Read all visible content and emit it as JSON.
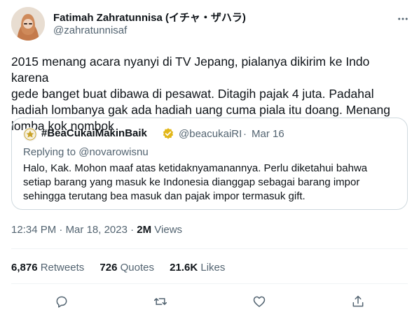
{
  "author": {
    "name": "Fatimah Zahratunnisa (イチャ・ザハラ)",
    "handle": "@zahratunnisaf"
  },
  "tweet": {
    "text": "2015 menang acara nyanyi di TV Jepang, pialanya dikirim ke Indo karena\ngede banget buat dibawa di pesawat. Ditagih pajak 4 juta. Padahal\nhadiah lombanya gak ada hadiah uang cuma piala itu doang. Menang\nlomba kok nombok"
  },
  "quote": {
    "name": "#BeaCukaiMakinBaik",
    "handle": "@beacukaiRI",
    "dot": "·",
    "date": "Mar 16",
    "replying_prefix": "Replying to ",
    "replying_to": "@novarowisnu",
    "text": "Halo, Kak. Mohon maaf atas ketidaknyamanannya. Perlu diketahui bahwa\nsetiap barang yang masuk ke Indonesia dianggap sebagai barang impor\nsehingga terutang bea masuk dan pajak impor termasuk gift."
  },
  "meta": {
    "time": "12:34 PM",
    "sep1": " · ",
    "date": "Mar 18, 2023",
    "sep2": " · ",
    "views_count": "2M",
    "views_label": " Views"
  },
  "stats": {
    "retweets_count": "6,876",
    "retweets_label": " Retweets",
    "quotes_count": "726",
    "quotes_label": " Quotes",
    "likes_count": "21.6K",
    "likes_label": " Likes"
  },
  "colors": {
    "text": "#0f1419",
    "secondary": "#536471",
    "verified_gold": "#e2b719",
    "border": "#cfd9de"
  },
  "icons": [
    "more-icon",
    "reply-icon",
    "retweet-icon",
    "like-icon",
    "share-icon",
    "verified-icon"
  ]
}
